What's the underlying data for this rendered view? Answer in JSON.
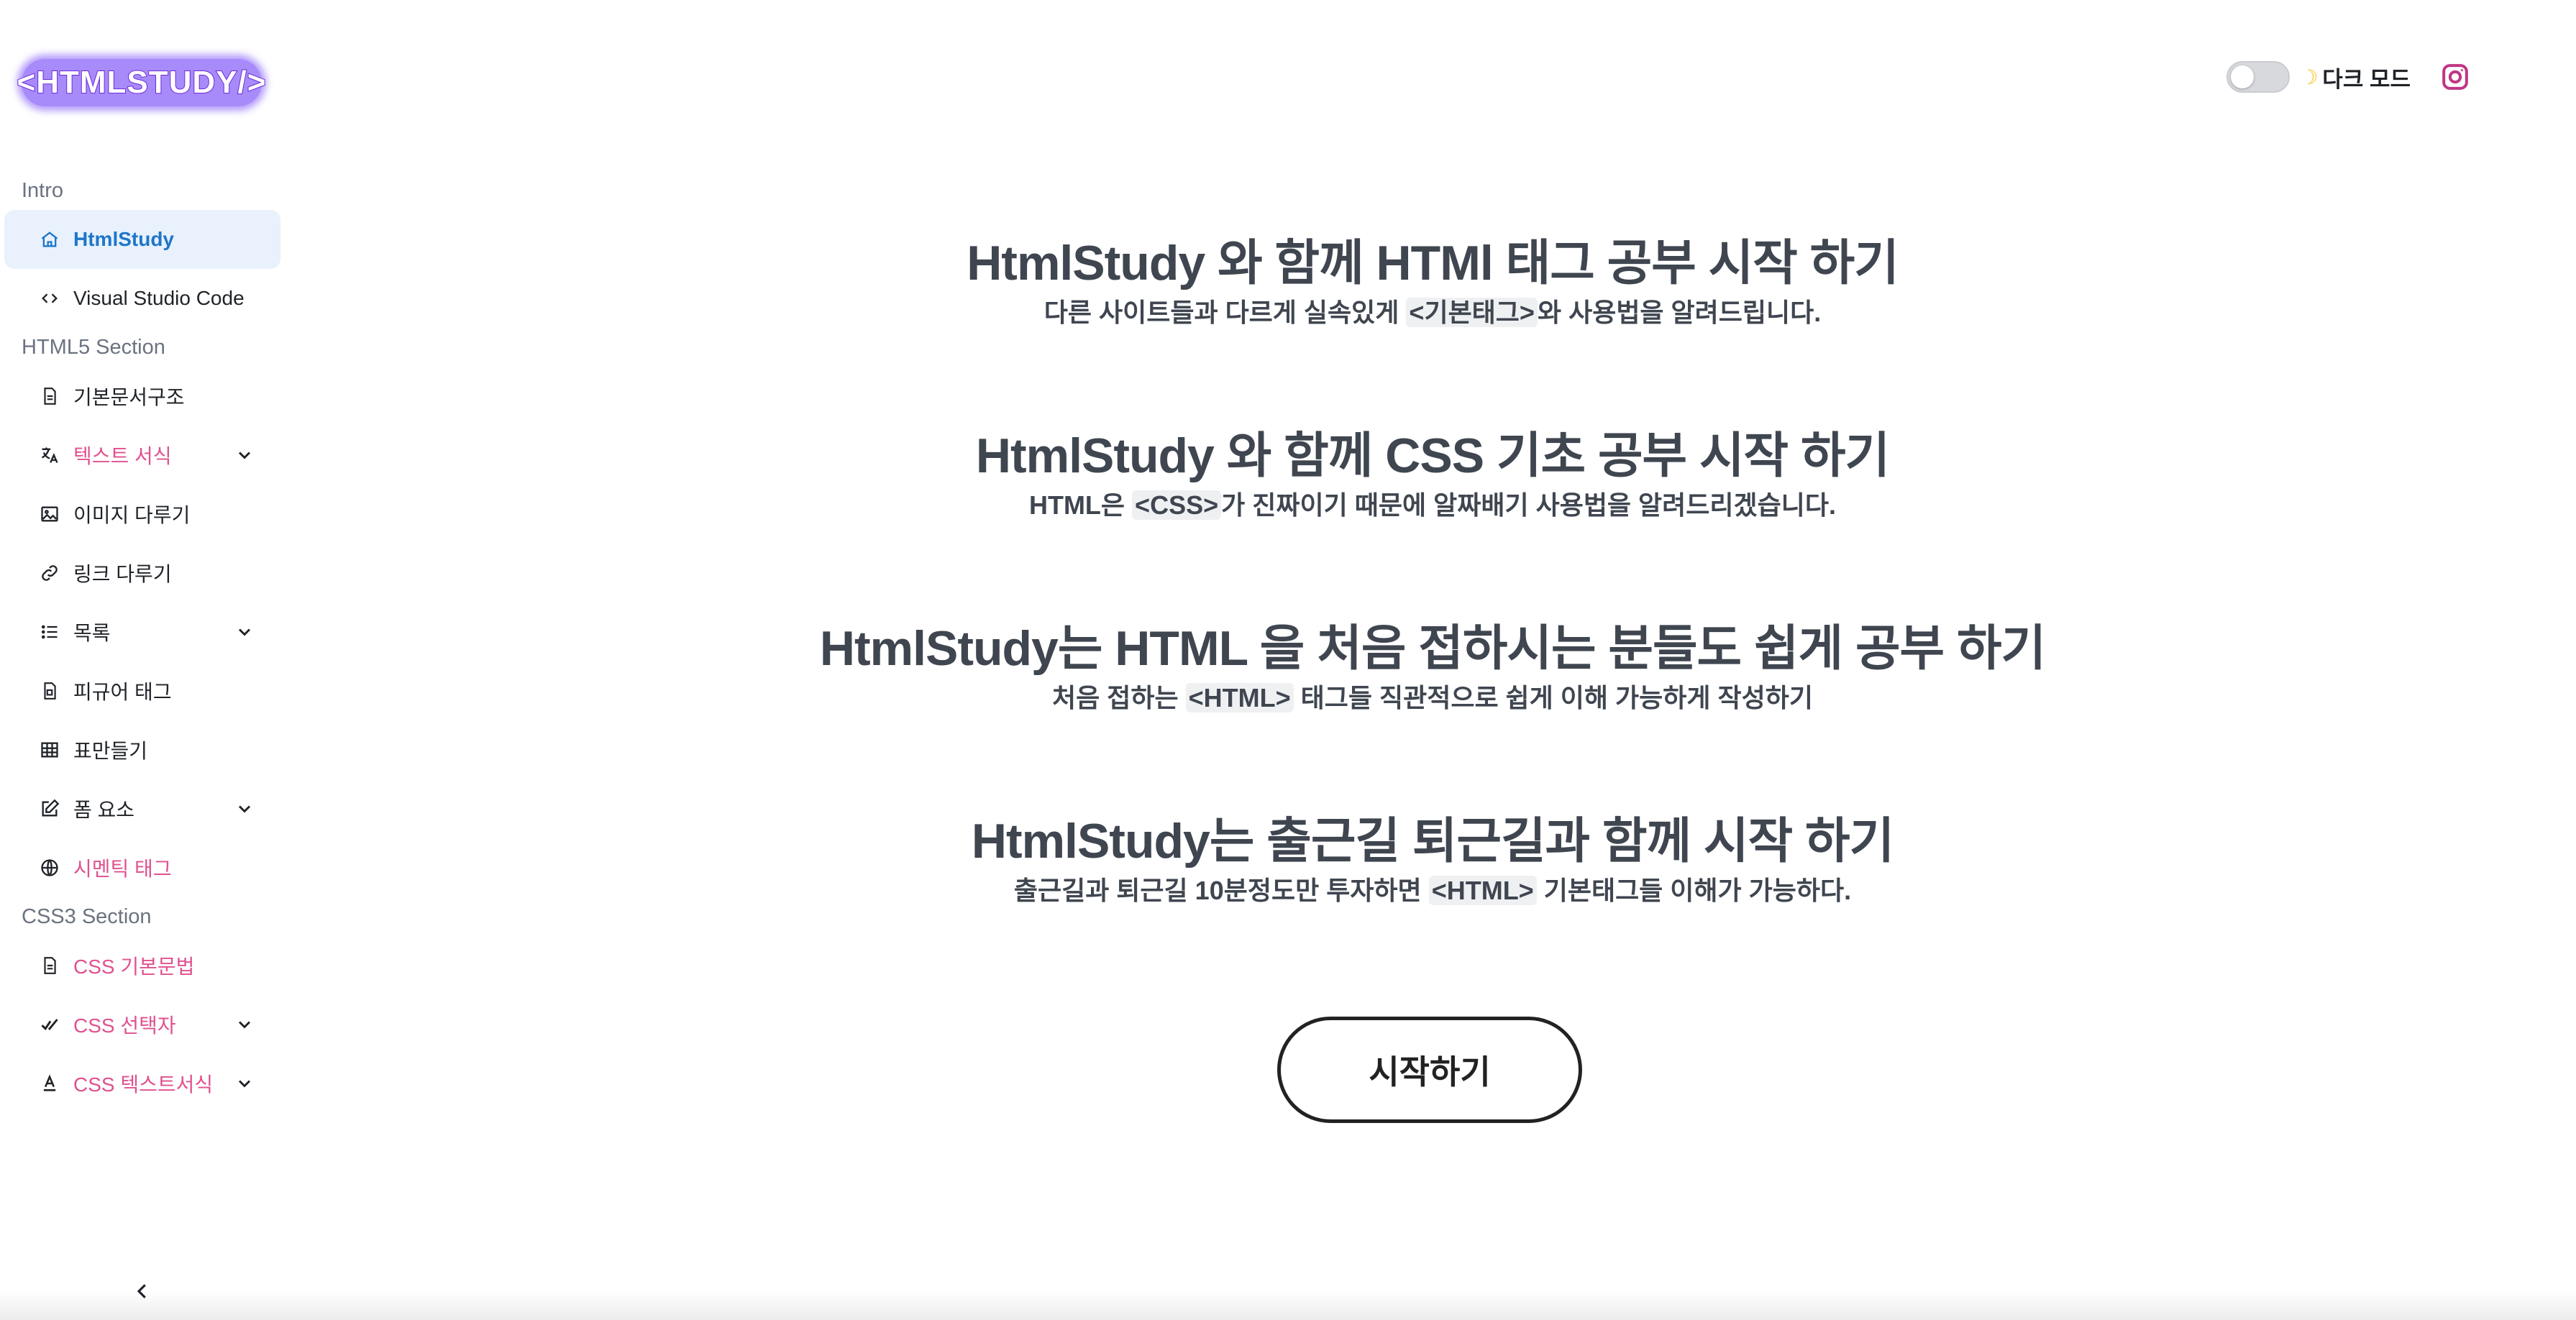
{
  "header": {
    "logo_text": "<HTMLSTUDY/>",
    "dark_mode_label": "다크 모드",
    "dark_mode_on": false
  },
  "sidebar": {
    "sections": [
      {
        "title": "Intro",
        "items": [
          {
            "label": "HtmlStudy",
            "icon": "home-icon",
            "active": true
          },
          {
            "label": "Visual Studio Code",
            "icon": "code-icon"
          }
        ]
      },
      {
        "title": "HTML5 Section",
        "items": [
          {
            "label": "기본문서구조",
            "icon": "document-icon"
          },
          {
            "label": "텍스트 서식",
            "icon": "translate-icon",
            "expandable": true
          },
          {
            "label": "이미지 다루기",
            "icon": "image-icon"
          },
          {
            "label": "링크 다루기",
            "icon": "link-icon"
          },
          {
            "label": "목록",
            "icon": "list-icon",
            "expandable": true
          },
          {
            "label": "피규어 태그",
            "icon": "figure-icon"
          },
          {
            "label": "표만들기",
            "icon": "table-icon"
          },
          {
            "label": "폼 요소",
            "icon": "edit-icon",
            "expandable": true
          },
          {
            "label": "시멘틱 태그",
            "icon": "globe-icon"
          }
        ]
      },
      {
        "title": "CSS3 Section",
        "items": [
          {
            "label": "CSS 기본문법",
            "icon": "document-icon"
          },
          {
            "label": "CSS 선택자",
            "icon": "check-icon",
            "expandable": true
          },
          {
            "label": "CSS 텍스트서식",
            "icon": "text-format-icon",
            "expandable": true
          }
        ]
      }
    ]
  },
  "main": {
    "blocks": [
      {
        "title": "HtmlStudy 와 함께 HTMl 태그 공부 시작 하기",
        "pre": "다른 사이트들과 다르게 실속있게 ",
        "tag": "<기본태그>",
        "post": "와 사용법을 알려드립니다."
      },
      {
        "title": "HtmlStudy 와 함께 CSS 기초 공부 시작 하기",
        "pre": "HTML은 ",
        "tag": "<CSS>",
        "post": "가 진짜이기 때문에 알짜배기 사용법을 알려드리겠습니다."
      },
      {
        "title": "HtmlStudy는 HTML 을 처음 접하시는 분들도 쉽게 공부 하기",
        "pre": "처음 접하는 ",
        "tag": "<HTML>",
        "post": " 태그들 직관적으로 쉽게 이해 가능하게 작성하기"
      },
      {
        "title": "HtmlStudy는 출근길 퇴근길과 함께 시작 하기",
        "pre": "출근길과 퇴근길 10분정도만 투자하면 ",
        "tag": "<HTML>",
        "post": " 기본태그들 이해가 가능하다."
      }
    ],
    "start_button": "시작하기"
  },
  "colors": {
    "active_bg": "#e8f1fc",
    "active_text": "#1e76c9",
    "pink_text": "#e0518f",
    "heading_text": "#3f4650",
    "logo_bg": "#a78bfa",
    "instagram": "#c13584"
  }
}
